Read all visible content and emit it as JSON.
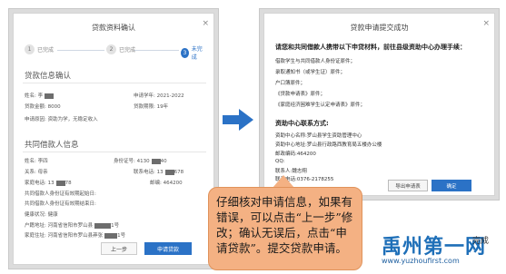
{
  "left_dialog": {
    "title": "贷款资料确认",
    "close": "×",
    "steps": [
      {
        "num": "1",
        "label": "已完成"
      },
      {
        "num": "2",
        "label": "已完成"
      },
      {
        "num": "3",
        "label": "未完成"
      }
    ],
    "loan_section_title": "贷款信息确认",
    "loan_rows": {
      "name": "姓名: 李",
      "apply_year": "申请学年: 2021-2022",
      "amount": "贷款金额: 8000",
      "term": "贷款期限: 19年",
      "reason": "申请原因: 资助为学，无稳定收入"
    },
    "co_section_title": "共同借款人信息",
    "co_rows": {
      "name": "姓名: 李四",
      "id": "身份证号: 4130",
      "id_tail": "40",
      "relation": "关系: 母亲",
      "contact": "联系电话: 13",
      "contact_tail": "678",
      "home_phone": "家庭电话: 13",
      "home_phone_mid": "78",
      "zip": "邮编: 464200",
      "id_front": "共同借款人身份证有效期起始日:",
      "id_back": "共同借款人身份证有效期结束日:",
      "health": "健康状况: 健康",
      "household": "户籍地址: 河南省信阳市罗山县",
      "household_tail": "1号",
      "home_addr": "家庭住址: 河南省信阳市罗山县莽张",
      "home_addr_tail": "1号"
    },
    "btn_prev": "上一步",
    "btn_apply": "申请贷款"
  },
  "right_dialog": {
    "title": "贷款申请提交成功",
    "close": "×",
    "heading": "请您和共同借款人携带以下申贷材料，前往县级资助中心办理手续：",
    "materials": [
      "借款学生与共同借款人身份证原件；",
      "录取通知书（或学生证）原件；",
      "户口簿原件；",
      "《贷款申请表》原件；",
      "《家庭经济困难学生认定申请表》原件；"
    ],
    "contact_heading": "资助中心联系方式:",
    "contact_lines": [
      "资助中心名称:罗山县学生资助管理中心",
      "资助中心地址:罗山县行政路西教育局五楼办公楼",
      "邮政编码:464200",
      "QQ:",
      "联系人:魏志翔",
      "联系电话:0376-2178255"
    ],
    "btn_export": "导出申请表",
    "btn_ok": "确定"
  },
  "callout": {
    "text": "仔细核对申请信息，如果有错误，可以点击“上一步”修改；确认无误后，点击“申请贷款”。提交贷款申请。"
  },
  "watermark": {
    "logo": "禹州第一网",
    "url": "www.yuzhoufirst.com",
    "side": "完成"
  }
}
